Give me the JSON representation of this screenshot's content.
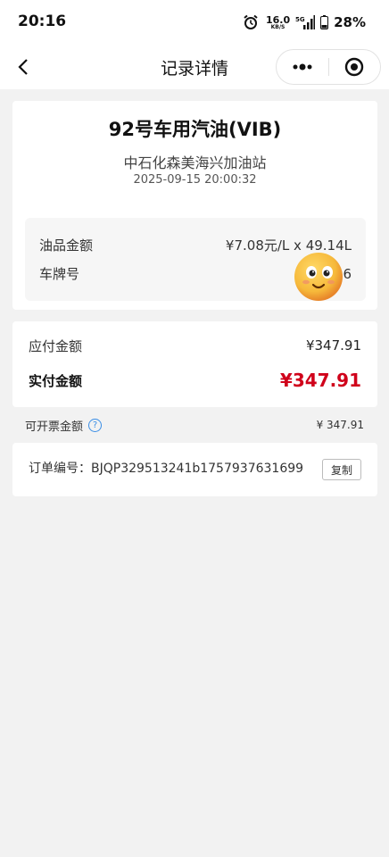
{
  "status_bar": {
    "time": "20:16",
    "net_speed": "16.0",
    "net_unit": "KB/S",
    "network": "5G",
    "battery": "28%"
  },
  "nav": {
    "title": "记录详情",
    "back_icon": "chevron-left-icon",
    "more_icon": "more-dots-icon",
    "close_icon": "target-circle-icon"
  },
  "record": {
    "product": "92号车用汽油(VIB)",
    "station": "中石化森美海兴加油站",
    "datetime": "2025-09-15 20:00:32",
    "details": [
      {
        "label": "油品金额",
        "value": "¥7.08元/L x 49.14L"
      },
      {
        "label": "车牌号",
        "value": "闽...6"
      }
    ]
  },
  "amount": {
    "payable_label": "应付金额",
    "payable_value": "¥347.91",
    "paid_label": "实付金额",
    "paid_value": "¥347.91"
  },
  "invoice": {
    "label": "可开票金额",
    "help": "?",
    "value": "¥ 347.91"
  },
  "order": {
    "label": "订单编号：",
    "number": "BJQP329513241b1757937631699",
    "copy_label": "复制"
  },
  "colors": {
    "accent_red": "#d0021b",
    "help_blue": "#3a8ee6",
    "emoji_yellow": "#f6b93b"
  }
}
